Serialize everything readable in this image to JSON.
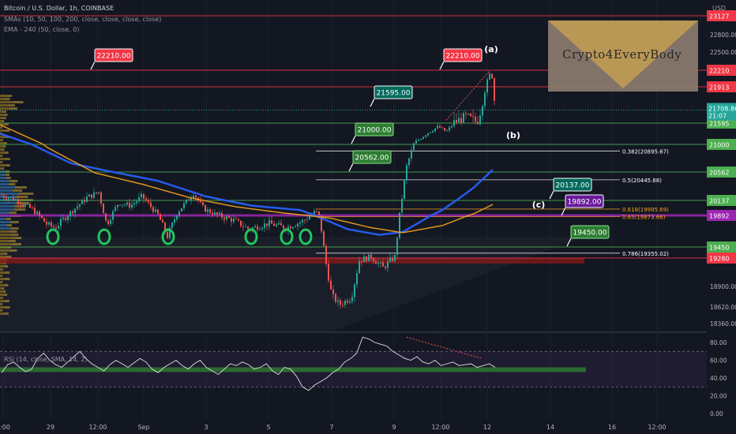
{
  "header": {
    "title": "Bitcoin / U.S. Dollar, 1h, COINBASE",
    "sma": "SMAs (10, 50, 100, 200, close, close, close, close)",
    "ema": "EMA - 240 (50, close, 0)",
    "rsi": "RSI (14, close, SMA, 14, 2)",
    "currency": "USD"
  },
  "logo": {
    "text": "Crypto4EveryBody"
  },
  "colors": {
    "background": "#131722",
    "up": "#26a69a",
    "down": "#ef5350",
    "sma_blue": "#2962ff",
    "ema_orange": "#f7a21b",
    "support": "#4caf50",
    "resistance": "#f23645",
    "fib": "#ffffff",
    "purple": "#9c27b0"
  },
  "chart_data": {
    "type": "candlestick",
    "x_ticks": [
      "2:00",
      "29",
      "12:00",
      "Sep",
      "3",
      "5",
      "7",
      "9",
      "12:00",
      "12",
      "14",
      "16",
      "12:00"
    ],
    "y_ticks": [
      23127,
      22800,
      22500,
      22210,
      21913,
      21595,
      21000,
      20562,
      20137,
      19892,
      19450,
      19280,
      18900,
      18620,
      18360
    ],
    "last_price": 21708.86,
    "countdown": "21:07",
    "horizontal_levels": [
      {
        "value": 23127,
        "kind": "resistance"
      },
      {
        "value": 22210,
        "kind": "resistance"
      },
      {
        "value": 21913,
        "kind": "resistance"
      },
      {
        "value": 21595,
        "kind": "support"
      },
      {
        "value": 21000,
        "kind": "support"
      },
      {
        "value": 20562,
        "kind": "support"
      },
      {
        "value": 20137,
        "kind": "support"
      },
      {
        "value": 19892,
        "kind": "purple"
      },
      {
        "value": 19450,
        "kind": "support"
      },
      {
        "value": 19280,
        "kind": "resistance"
      }
    ],
    "callouts": [
      {
        "text": "22210.00",
        "kind": "resistance"
      },
      {
        "text": "22210.00",
        "kind": "resistance"
      },
      {
        "text": "21595.00",
        "kind": "teal"
      },
      {
        "text": "21000.00",
        "kind": "support"
      },
      {
        "text": "20562.00",
        "kind": "support"
      },
      {
        "text": "20137.00",
        "kind": "teal"
      },
      {
        "text": "19892.00",
        "kind": "purple"
      },
      {
        "text": "19450.00",
        "kind": "support"
      }
    ],
    "fib_levels": [
      {
        "label": "0.382(20895.67)",
        "value": 20895.67
      },
      {
        "label": "0.5(20445.68)",
        "value": 20445.68
      },
      {
        "label": "0.618(19995.69)",
        "value": 19995.69
      },
      {
        "label": "0.65(19873.66)",
        "value": 19873.66
      },
      {
        "label": "0.786(19355.02)",
        "value": 19355.02
      }
    ],
    "wave_labels": [
      "(a)",
      "(b)",
      "(c)"
    ],
    "rsi": {
      "ticks": [
        80,
        60,
        40,
        20,
        0
      ],
      "upper": 70,
      "lower": 30,
      "series": [
        46,
        55,
        58,
        52,
        47,
        50,
        62,
        68,
        60,
        55,
        52,
        58,
        64,
        70,
        62,
        56,
        52,
        48,
        55,
        60,
        56,
        52,
        57,
        62,
        58,
        50,
        46,
        52,
        56,
        60,
        54,
        50,
        56,
        60,
        52,
        48,
        44,
        50,
        56,
        54,
        58,
        55,
        50,
        52,
        56,
        48,
        44,
        52,
        50,
        42,
        30,
        26,
        32,
        36,
        40,
        46,
        50,
        58,
        62,
        68,
        86,
        84,
        80,
        78,
        76,
        70,
        66,
        62,
        60,
        64,
        58,
        56,
        60,
        54,
        56,
        58,
        54,
        55,
        56,
        52,
        54,
        56,
        52
      ]
    }
  }
}
